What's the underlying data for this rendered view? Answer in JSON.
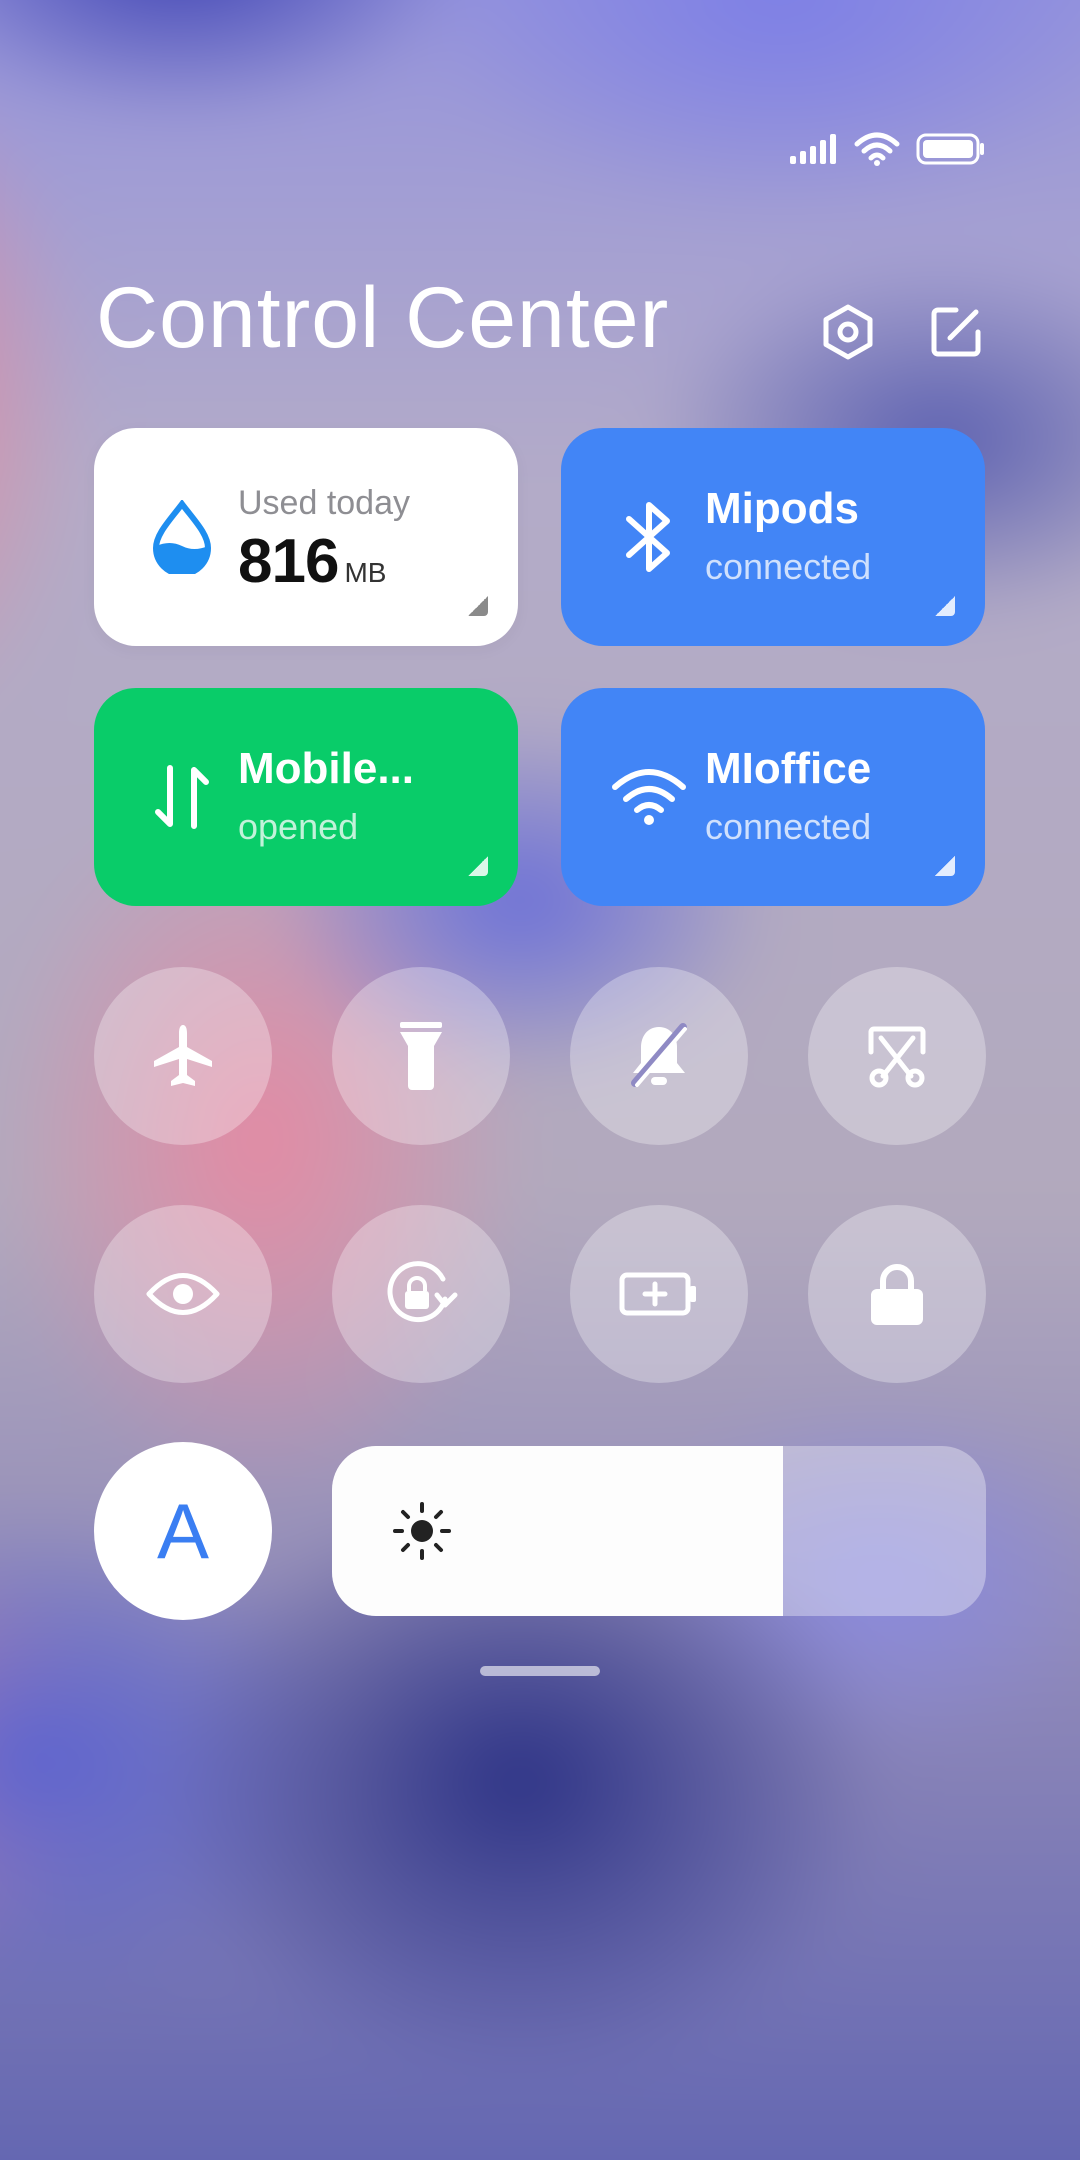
{
  "header": {
    "title": "Control Center"
  },
  "tiles": {
    "data_usage": {
      "label": "Used today",
      "value": "816",
      "unit": "MB"
    },
    "bluetooth": {
      "name": "Mipods",
      "status": "connected"
    },
    "mobile_data": {
      "name": "Mobile...",
      "status": "opened"
    },
    "wifi": {
      "name": "MIoffice",
      "status": "connected"
    }
  },
  "toggles": [
    {
      "icon": "airplane-icon"
    },
    {
      "icon": "flashlight-icon"
    },
    {
      "icon": "mute-icon"
    },
    {
      "icon": "screenshot-icon"
    },
    {
      "icon": "reading-mode-icon"
    },
    {
      "icon": "rotation-lock-icon"
    },
    {
      "icon": "battery-saver-icon"
    },
    {
      "icon": "lock-screen-icon"
    }
  ],
  "auto_brightness": {
    "label": "A"
  },
  "brightness": {
    "level_percent": 69
  },
  "colors": {
    "blue": "#4285f6",
    "green": "#09cc69",
    "accent": "#3a7ef2"
  }
}
